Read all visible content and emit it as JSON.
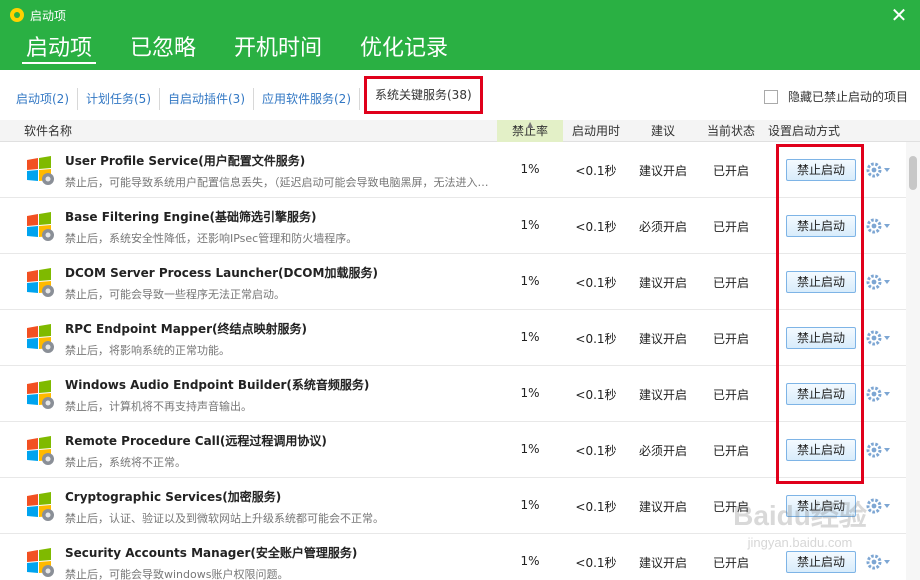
{
  "window": {
    "title": "启动项",
    "close_glyph": "✕"
  },
  "main_tabs": [
    {
      "label": "启动项",
      "active": true
    },
    {
      "label": "已忽略",
      "active": false
    },
    {
      "label": "开机时间",
      "active": false
    },
    {
      "label": "优化记录",
      "active": false
    }
  ],
  "sub_tabs": [
    {
      "label": "启动项(2)"
    },
    {
      "label": "计划任务(5)"
    },
    {
      "label": "自启动插件(3)"
    },
    {
      "label": "应用软件服务(2)"
    },
    {
      "label": "系统关键服务(38)",
      "active": true
    }
  ],
  "hide_disabled_label": "隐藏已禁止启动的项目",
  "columns": {
    "name": "软件名称",
    "rate": "禁止率",
    "time": "启动用时",
    "suggestion": "建议",
    "state": "当前状态",
    "mode": "设置启动方式"
  },
  "rows": [
    {
      "name": "User Profile Service(用户配置文件服务)",
      "desc": "禁止后，可能导致系统用户配置信息丢失，（延迟启动可能会导致电脑黑屏，无法进入桌面）",
      "rate": "1%",
      "time": "<0.1秒",
      "suggestion": "建议开启",
      "state": "已开启",
      "button": "禁止启动"
    },
    {
      "name": "Base Filtering Engine(基础筛选引擎服务)",
      "desc": "禁止后，系统安全性降低，还影响IPsec管理和防火墙程序。",
      "rate": "1%",
      "time": "<0.1秒",
      "suggestion": "必须开启",
      "state": "已开启",
      "button": "禁止启动"
    },
    {
      "name": "DCOM Server Process Launcher(DCOM加载服务)",
      "desc": "禁止后，可能会导致一些程序无法正常启动。",
      "rate": "1%",
      "time": "<0.1秒",
      "suggestion": "建议开启",
      "state": "已开启",
      "button": "禁止启动"
    },
    {
      "name": "RPC Endpoint Mapper(终结点映射服务)",
      "desc": "禁止后，将影响系统的正常功能。",
      "rate": "1%",
      "time": "<0.1秒",
      "suggestion": "建议开启",
      "state": "已开启",
      "button": "禁止启动"
    },
    {
      "name": "Windows Audio Endpoint Builder(系统音频服务)",
      "desc": "禁止后，计算机将不再支持声音输出。",
      "rate": "1%",
      "time": "<0.1秒",
      "suggestion": "建议开启",
      "state": "已开启",
      "button": "禁止启动"
    },
    {
      "name": "Remote Procedure Call(远程过程调用协议)",
      "desc": "禁止后，系统将不正常。",
      "rate": "1%",
      "time": "<0.1秒",
      "suggestion": "必须开启",
      "state": "已开启",
      "button": "禁止启动"
    },
    {
      "name": "Cryptographic Services(加密服务)",
      "desc": "禁止后，认证、验证以及到微软网站上升级系统都可能会不正常。",
      "rate": "1%",
      "time": "<0.1秒",
      "suggestion": "建议开启",
      "state": "已开启",
      "button": "禁止启动"
    },
    {
      "name": "Security Accounts Manager(安全账户管理服务)",
      "desc": "禁止后，可能会导致windows账户权限问题。",
      "rate": "1%",
      "time": "<0.1秒",
      "suggestion": "建议开启",
      "state": "已开启",
      "button": "禁止启动"
    }
  ],
  "watermark": {
    "text": "Baidu经验",
    "url_text": "jingyan.baidu.com"
  },
  "colors": {
    "header_green": "#2ab043",
    "highlight_red": "#e0001b",
    "link_blue": "#3378c4"
  }
}
